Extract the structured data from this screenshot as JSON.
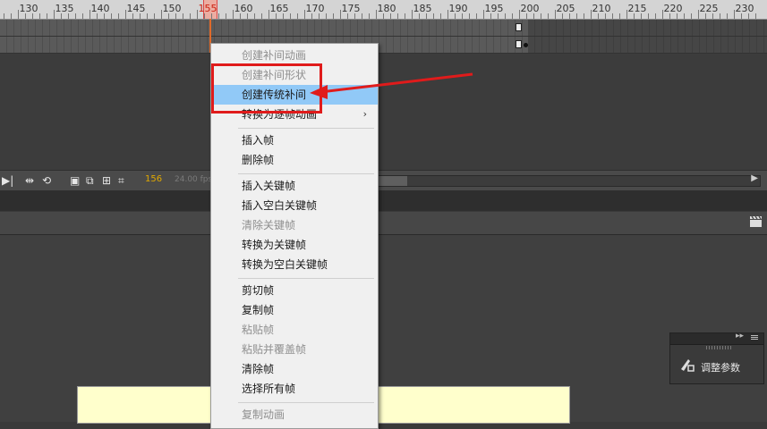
{
  "timeline": {
    "ruler_labels": [
      "130",
      "135",
      "140",
      "145",
      "150",
      "155",
      "160",
      "165",
      "170",
      "175",
      "180",
      "185",
      "190",
      "195",
      "200",
      "205",
      "210",
      "215",
      "220",
      "225",
      "230"
    ],
    "current_frame_label": "156",
    "fps_label": "24.00 fps"
  },
  "context_menu": {
    "items": [
      {
        "label": "创建补间动画",
        "disabled": true
      },
      {
        "label": "创建补间形状",
        "disabled": true
      },
      {
        "label": "创建传统补间",
        "disabled": false,
        "highlight": true
      },
      {
        "label": "转换为逐帧动画",
        "disabled": false,
        "submenu": true
      },
      {
        "label": "插入帧",
        "disabled": false
      },
      {
        "label": "删除帧",
        "disabled": false
      },
      {
        "label": "插入关键帧",
        "disabled": false
      },
      {
        "label": "插入空白关键帧",
        "disabled": false
      },
      {
        "label": "清除关键帧",
        "disabled": true
      },
      {
        "label": "转换为关键帧",
        "disabled": false
      },
      {
        "label": "转换为空白关键帧",
        "disabled": false
      },
      {
        "label": "剪切帧",
        "disabled": false
      },
      {
        "label": "复制帧",
        "disabled": false
      },
      {
        "label": "粘贴帧",
        "disabled": true
      },
      {
        "label": "粘贴并覆盖帧",
        "disabled": true
      },
      {
        "label": "清除帧",
        "disabled": false
      },
      {
        "label": "选择所有帧",
        "disabled": false
      },
      {
        "label": "复制动画",
        "disabled": true
      }
    ]
  },
  "mini_panel": {
    "label": "调整参数"
  },
  "colors": {
    "highlight": "#91c9f7",
    "annotation_red": "#e01b1b",
    "playhead": "#e06a2a",
    "frame_counter": "#e0a800"
  }
}
